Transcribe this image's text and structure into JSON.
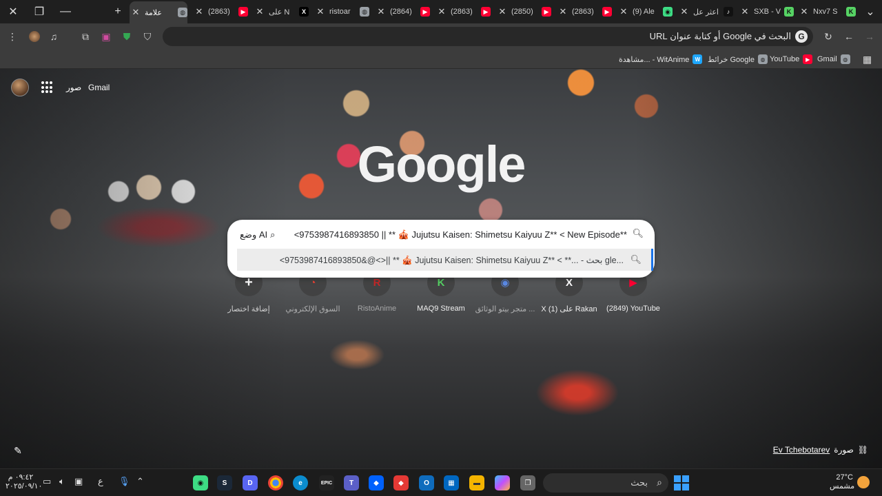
{
  "tabs": [
    {
      "title": "Nxv7 S",
      "favicon": "K",
      "color": "#56d364"
    },
    {
      "title": "SXB - V",
      "favicon": "K",
      "color": "#56d364"
    },
    {
      "title": "اعثر عل",
      "favicon": "♪",
      "color": "#111111"
    },
    {
      "title": "(9) Ale",
      "favicon": "◉",
      "color": "#3ddc84"
    },
    {
      "title": "(2863)",
      "favicon": "▶",
      "color": "#ff0033"
    },
    {
      "title": "(2850)",
      "favicon": "▶",
      "color": "#ff0033"
    },
    {
      "title": "(2863)",
      "favicon": "▶",
      "color": "#ff0033"
    },
    {
      "title": "(2864)",
      "favicon": "▶",
      "color": "#ff0033"
    },
    {
      "title": "ristoar",
      "favicon": "◍",
      "color": "#9aa0a6"
    },
    {
      "title": "على N",
      "favicon": "X",
      "color": "#000000"
    },
    {
      "title": "(2863)",
      "favicon": "▶",
      "color": "#ff0033"
    },
    {
      "title": "علامة",
      "favicon": "◍",
      "color": "#9aa0a6"
    }
  ],
  "omnibox": {
    "text": "البحث في Google أو كتابة عنوان URL"
  },
  "bookmarks": [
    {
      "label": "Gmail",
      "icon": "◍",
      "color": "#9aa0a6"
    },
    {
      "label": "YouTube",
      "icon": "▶",
      "color": "#ff0033"
    },
    {
      "label": "خرائط Google",
      "icon": "◍",
      "color": "#9aa0a6"
    },
    {
      "label": "مشاهدة... - WitAnime",
      "icon": "W",
      "color": "#1ea7fd"
    }
  ],
  "page": {
    "gmail_label": "Gmail",
    "images_label": "صور",
    "logo": "Google",
    "search_query": "<9753987416893850 || ** 🎪 Jujutsu Kaisen: Shimetsu Kaiyuu Z** <  New Episode**",
    "ai_mode_label": "وضع AI",
    "suggestion": "<9753987416893850&@<>|| ** 🎪 Jujutsu Kaisen: Shimetsu Kaiyuu Z** < **...  - بحث gle...",
    "shortcuts": [
      {
        "label": "(2849) YouTube",
        "icon": "▶",
        "color": "#ff0033"
      },
      {
        "label": "X على (1) Rakan",
        "icon": "X",
        "color": "#111111"
      },
      {
        "label": "متجر بيتو الوثائق ...",
        "icon": "◉",
        "color": "#2c5bb8"
      },
      {
        "label": "MAQ9 Stream",
        "icon": "K",
        "color": "#56d364"
      },
      {
        "label": "RistoAnime",
        "icon": "R",
        "color": "#c62828"
      },
      {
        "label": "السوق الإلكتروني",
        "icon": "◔",
        "color": "#e94235"
      },
      {
        "label": "إضافة اختصار",
        "icon": "+",
        "color": "#444444"
      }
    ],
    "credit_label": "صورة",
    "credit_author": "Ev Tchebotarev"
  },
  "taskbar": {
    "time": "٠٩:٤٢ م",
    "date": "٢٠٢٥/٠٩/١٠",
    "search_label": "بحث",
    "weather_temp": "27°C",
    "weather_desc": "مشمس",
    "lang": "ع"
  }
}
